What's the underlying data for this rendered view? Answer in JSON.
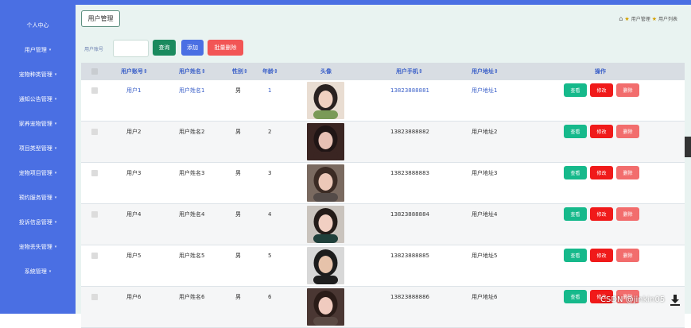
{
  "sidebar": {
    "items": [
      {
        "label": "个人中心"
      },
      {
        "label": "用户管理"
      },
      {
        "label": "宠物种类管理"
      },
      {
        "label": "通知公告管理"
      },
      {
        "label": "家养宠物管理"
      },
      {
        "label": "项目类型管理"
      },
      {
        "label": "宠物项目管理"
      },
      {
        "label": "预约服务管理"
      },
      {
        "label": "投诉信息管理"
      },
      {
        "label": "宠物丢失管理"
      },
      {
        "label": "系统管理"
      }
    ]
  },
  "header": {
    "tab_label": "用户管理",
    "breadcrumb": [
      "用户管理",
      "用户列表"
    ]
  },
  "search": {
    "label": "用户账号",
    "value": "",
    "query_label": "查询",
    "add_label": "添加",
    "batch_delete_label": "批量删除"
  },
  "table": {
    "columns": {
      "account": "用户账号",
      "name": "用户姓名",
      "gender": "性别",
      "age": "年龄",
      "avatar": "头像",
      "phone": "用户手机",
      "address": "用户地址",
      "actions": "操作"
    },
    "sort_icon": "sort-icon",
    "action_labels": {
      "view": "查看",
      "edit": "修改",
      "delete": "删除"
    },
    "rows": [
      {
        "account": "用户1",
        "name": "用户姓名1",
        "gender": "男",
        "age": "1",
        "phone": "13823888881",
        "address": "用户地址1"
      },
      {
        "account": "用户2",
        "name": "用户姓名2",
        "gender": "男",
        "age": "2",
        "phone": "13823888882",
        "address": "用户地址2"
      },
      {
        "account": "用户3",
        "name": "用户姓名3",
        "gender": "男",
        "age": "3",
        "phone": "13823888883",
        "address": "用户地址3"
      },
      {
        "account": "用户4",
        "name": "用户姓名4",
        "gender": "男",
        "age": "4",
        "phone": "13823888884",
        "address": "用户地址4"
      },
      {
        "account": "用户5",
        "name": "用户姓名5",
        "gender": "男",
        "age": "5",
        "phone": "13823888885",
        "address": "用户地址5"
      },
      {
        "account": "用户6",
        "name": "用户姓名6",
        "gender": "男",
        "age": "6",
        "phone": "13823888886",
        "address": "用户地址6"
      }
    ]
  },
  "watermark": "CSDN @jinkin05",
  "colors": {
    "sidebar": "#4a6fe3",
    "main_bg": "#e9f3f1",
    "header_text": "#3a5fc8",
    "view_button": "#16b98b",
    "edit_button": "#f01a1a",
    "delete_button": "#f26d6d"
  }
}
